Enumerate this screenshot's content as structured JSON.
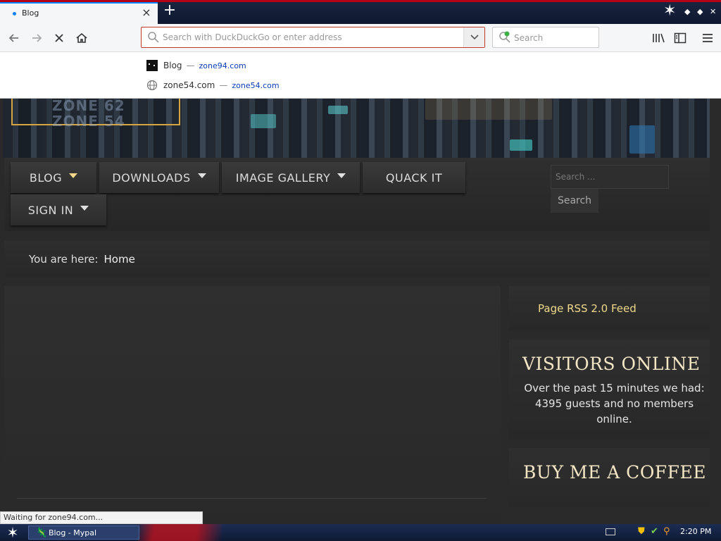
{
  "browser": {
    "tab_title": "Blog",
    "tab_close": "×",
    "new_tab": "+",
    "urlbar_placeholder": "Search with DuckDuckGo or enter address",
    "searchbar_placeholder": "Search",
    "suggestions": [
      {
        "title": "Blog",
        "url": "zone94.com"
      },
      {
        "title": "zone54.com",
        "url": "zone54.com"
      }
    ],
    "status": "Waiting for zone94.com..."
  },
  "banner": {
    "logo_line1": "ZONE 62",
    "logo_line2": "ZONE 54"
  },
  "menu": {
    "items": [
      {
        "label": "BLOG",
        "has_caret": true,
        "active": true
      },
      {
        "label": "DOWNLOADS",
        "has_caret": true
      },
      {
        "label": "IMAGE GALLERY",
        "has_caret": true
      },
      {
        "label": "QUACK IT",
        "has_caret": false
      },
      {
        "label": "SIGN IN",
        "has_caret": true
      }
    ],
    "search_placeholder": "Search ...",
    "search_button": "Search"
  },
  "breadcrumb": {
    "prefix": "You are here:",
    "current": "Home"
  },
  "sidebar": {
    "rss": "Page RSS 2.0 Feed",
    "visitors_title": "VISITORS ONLINE",
    "visitors_text": "Over the past 15 minutes we had: 4395 guests and no members online.",
    "coffee_title": "BUY ME A COFFEE"
  },
  "taskbar": {
    "item": "Blog - Mypal",
    "clock": "2:20 PM"
  },
  "colors": {
    "accent_red": "#b30016",
    "link_gold": "#f0d98a",
    "heading_cream": "#f3e6c5"
  }
}
